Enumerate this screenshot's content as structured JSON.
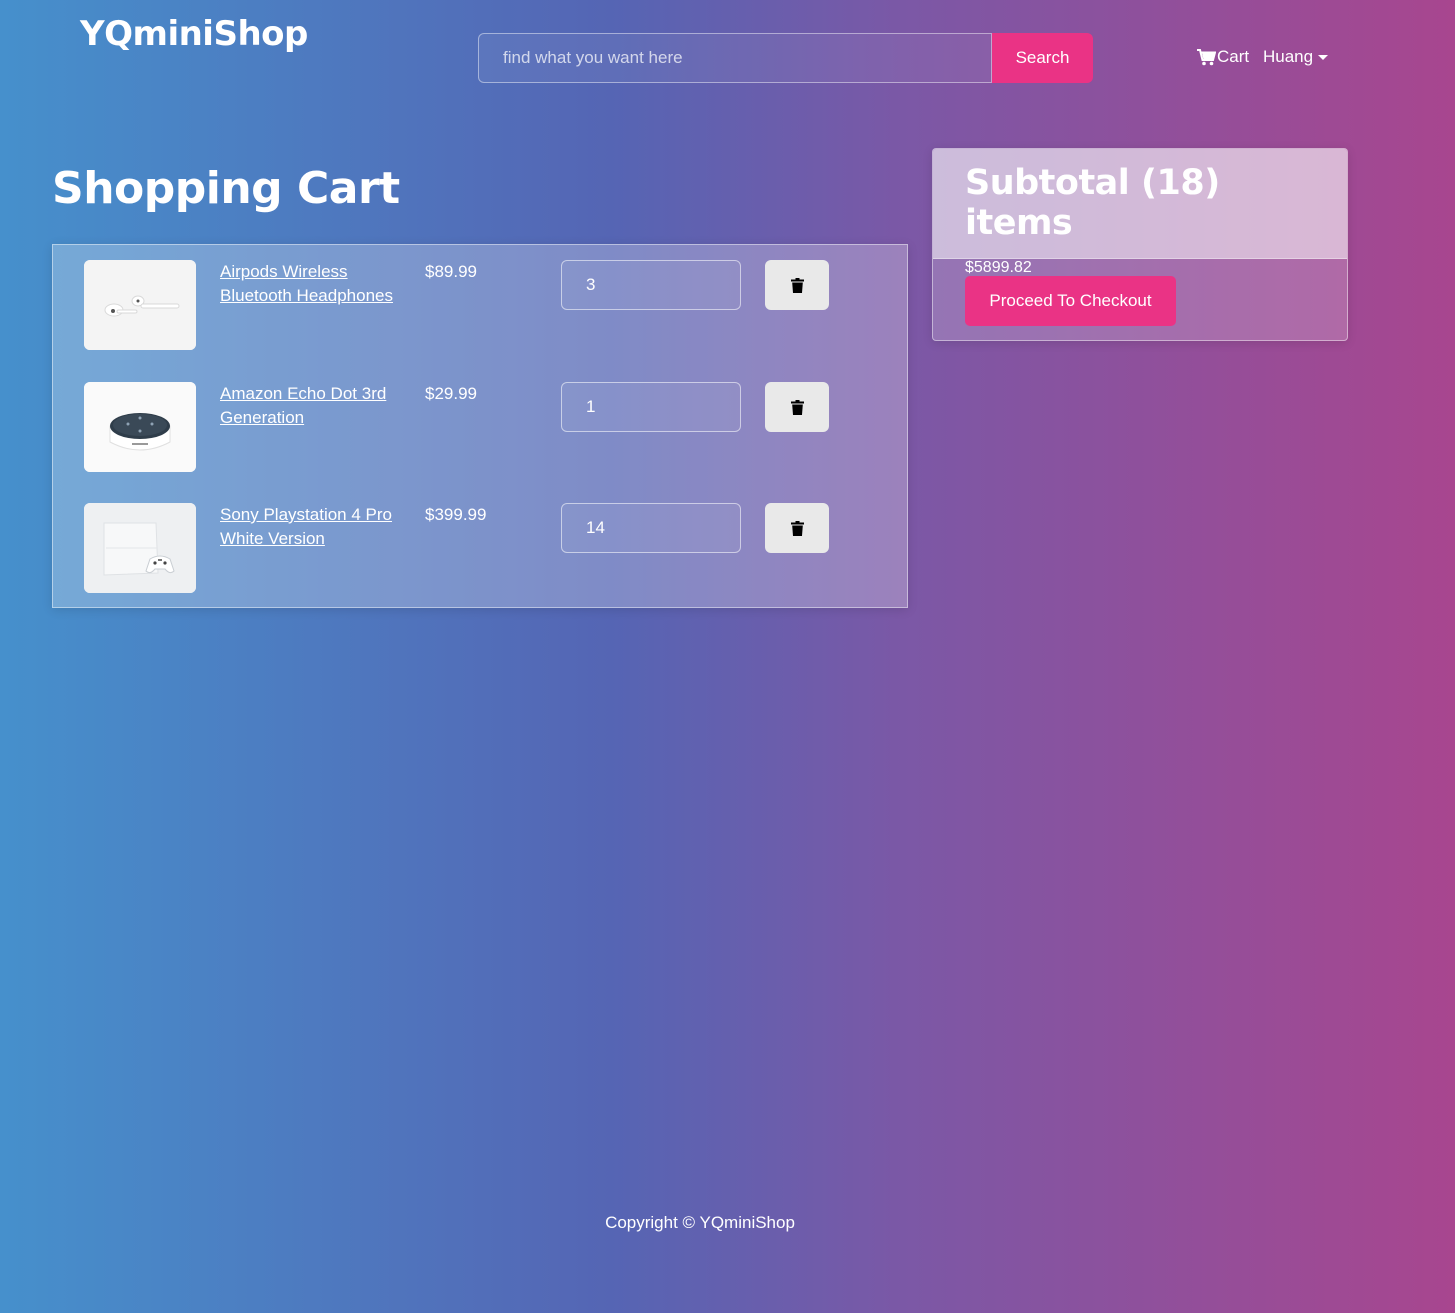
{
  "header": {
    "brand": "YQminiShop",
    "search_placeholder": "find what you want here",
    "search_button": "Search",
    "cart_label": "Cart",
    "user_name": "Huang"
  },
  "page": {
    "title": "Shopping Cart"
  },
  "cart_items": [
    {
      "name": "Airpods Wireless Bluetooth Headphones",
      "price": "$89.99",
      "qty": "3",
      "image": "airpods"
    },
    {
      "name": "Amazon Echo Dot 3rd Generation",
      "price": "$29.99",
      "qty": "1",
      "image": "echo-dot"
    },
    {
      "name": "Sony Playstation 4 Pro White Version",
      "price": "$399.99",
      "qty": "14",
      "image": "ps4"
    }
  ],
  "summary": {
    "title": "Subtotal (18) items",
    "total": "$5899.82",
    "checkout_button": "Proceed To Checkout"
  },
  "footer": {
    "copyright": "Copyright © YQminiShop"
  },
  "colors": {
    "accent": "#ea3385",
    "delete_button": "#e9e9e9"
  },
  "icons": {
    "cart": "cart-icon",
    "delete": "trash-icon",
    "dropdown": "caret-down-icon"
  }
}
